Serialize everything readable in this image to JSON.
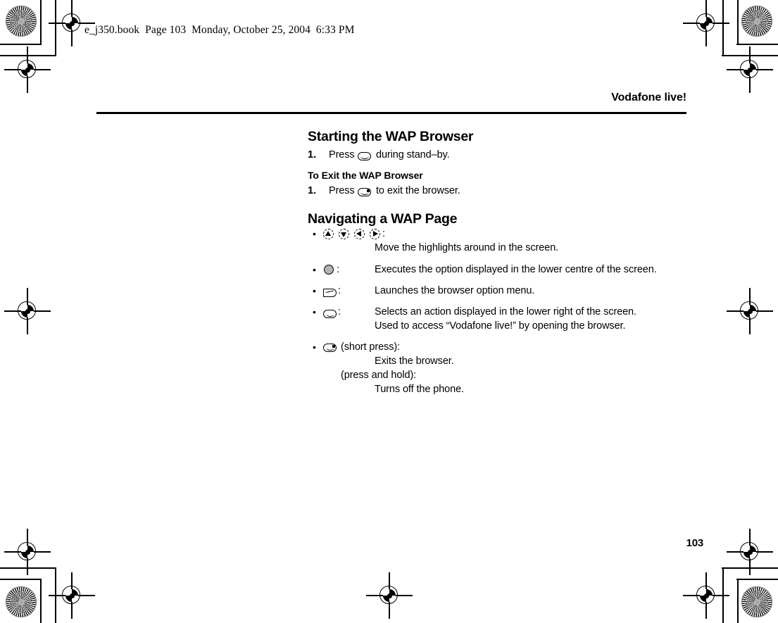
{
  "document": {
    "file_header": "e_j350.book  Page 103  Monday, October 25, 2004  6:33 PM",
    "running_head": "Vodafone live!",
    "page_number": "103"
  },
  "sections": [
    {
      "heading": "Starting the WAP Browser",
      "steps": [
        {
          "number": "1.",
          "text_before": "Press",
          "key_icon": "softkey-right-browser-icon",
          "text_after": "during stand–by."
        }
      ]
    },
    {
      "subheading": "To Exit the WAP Browser",
      "steps": [
        {
          "number": "1.",
          "text_before": "Press",
          "key_icon": "end-key-icon",
          "text_after": "to exit the browser."
        }
      ]
    },
    {
      "heading": "Navigating a WAP Page",
      "items": [
        {
          "bullet": "•",
          "icons": [
            "nav-up-key-icon",
            "nav-down-key-icon",
            "nav-left-key-icon",
            "nav-right-key-icon"
          ],
          "colon": ":",
          "description_lines": [
            "Move the highlights around in the screen."
          ]
        },
        {
          "bullet": "•",
          "icons": [
            "centre-select-key-icon"
          ],
          "colon": ":",
          "description_lines": [
            "Executes the option displayed in the lower centre of the screen."
          ]
        },
        {
          "bullet": "•",
          "icons": [
            "left-softkey-icon"
          ],
          "colon": ":",
          "description_lines": [
            "Launches the browser option menu."
          ]
        },
        {
          "bullet": "•",
          "icons": [
            "right-softkey-icon"
          ],
          "colon": ":",
          "description_lines": [
            "Selects an action displayed in the lower right of the screen.",
            "Used to access “Vodafone live!” by opening the browser."
          ]
        },
        {
          "bullet": "•",
          "icons": [
            "end-key-icon"
          ],
          "press_short_label": "(short press):",
          "press_hold_label": "(press and hold):",
          "description_lines": [
            "Exits the browser.",
            "Turns off the phone."
          ]
        }
      ]
    }
  ],
  "colors": {
    "ink": "#000000",
    "centre_key_fill": "#b3b3b3",
    "paper": "#ffffff"
  }
}
